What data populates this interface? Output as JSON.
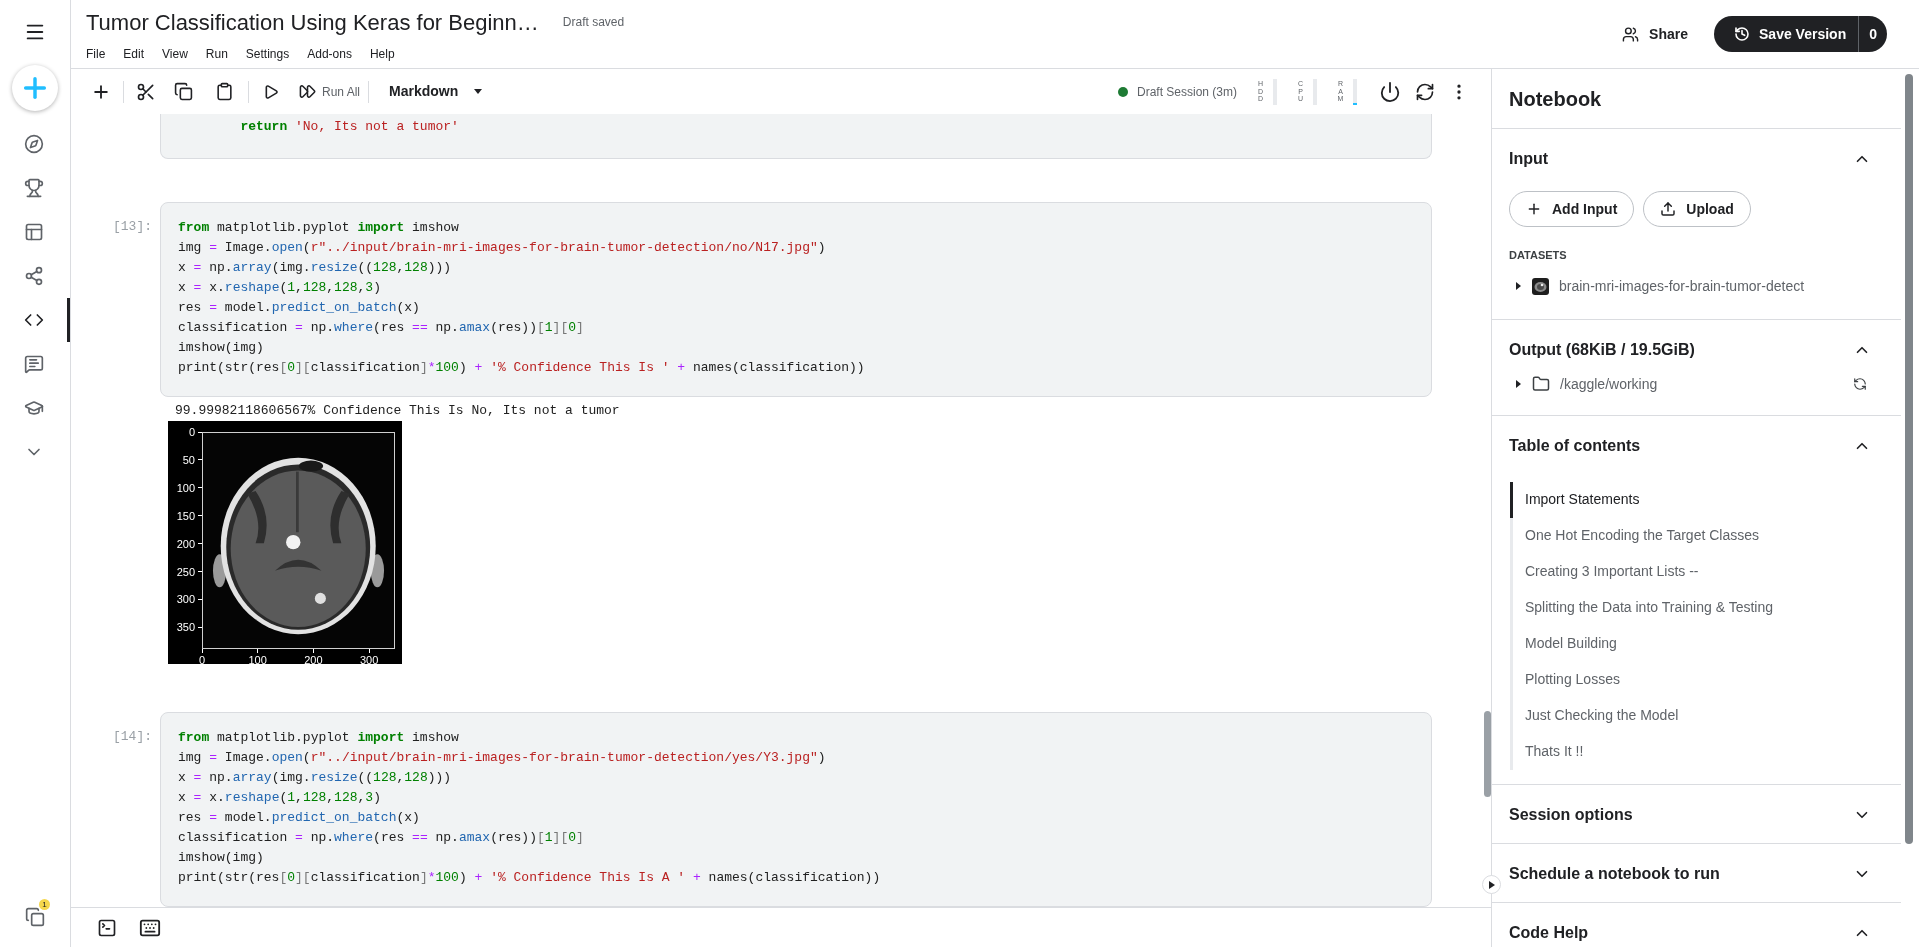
{
  "sidebar": {
    "items": [
      {
        "selected": false
      },
      {
        "selected": false
      },
      {
        "selected": false
      },
      {
        "selected": false
      },
      {
        "selected": true
      },
      {
        "selected": false
      },
      {
        "selected": false
      },
      {
        "selected": false
      }
    ],
    "badge": "1"
  },
  "header": {
    "title": "Tumor Classification Using Keras for Beginn…",
    "status": "Draft saved",
    "menu": [
      "File",
      "Edit",
      "View",
      "Run",
      "Settings",
      "Add-ons",
      "Help"
    ],
    "share": "Share",
    "save_version": {
      "label": "Save Version",
      "count": "0"
    }
  },
  "toolbar": {
    "run_all": "Run All",
    "cell_type": "Markdown",
    "session": {
      "label": "Draft Session (3m)",
      "running": true
    },
    "meters": [
      {
        "label": "HDD",
        "level": 0
      },
      {
        "label": "CPU",
        "level": 0
      },
      {
        "label": "RAM",
        "level": 0.06
      }
    ]
  },
  "cells": [
    {
      "lines": [
        [
          {
            "kind": "kw",
            "text": "        return"
          },
          {
            "kind": "str",
            "text": " 'No, Its not a tumor'"
          }
        ]
      ]
    },
    {
      "label": "[13]:",
      "lines": [
        [
          {
            "kind": "kw",
            "text": "from"
          },
          {
            "kind": "plain",
            "text": " matplotlib.pyplot "
          },
          {
            "kind": "kw",
            "text": "import"
          },
          {
            "kind": "plain",
            "text": " imshow"
          }
        ],
        [
          {
            "kind": "plain",
            "text": "img "
          },
          {
            "kind": "op",
            "text": "="
          },
          {
            "kind": "plain",
            "text": " Image."
          },
          {
            "kind": "fn",
            "text": "open"
          },
          {
            "kind": "plain",
            "text": "("
          },
          {
            "kind": "str",
            "text": "r\"../input/brain-mri-images-for-brain-tumor-detection/no/N17.jpg\""
          },
          {
            "kind": "plain",
            "text": ")"
          }
        ],
        [
          {
            "kind": "plain",
            "text": "x "
          },
          {
            "kind": "op",
            "text": "="
          },
          {
            "kind": "plain",
            "text": " np."
          },
          {
            "kind": "fn",
            "text": "array"
          },
          {
            "kind": "plain",
            "text": "(img."
          },
          {
            "kind": "fn",
            "text": "resize"
          },
          {
            "kind": "plain",
            "text": "(("
          },
          {
            "kind": "num",
            "text": "128"
          },
          {
            "kind": "plain",
            "text": ","
          },
          {
            "kind": "num",
            "text": "128"
          },
          {
            "kind": "plain",
            "text": ")))"
          }
        ],
        [
          {
            "kind": "plain",
            "text": "x "
          },
          {
            "kind": "op",
            "text": "="
          },
          {
            "kind": "plain",
            "text": " x."
          },
          {
            "kind": "fn",
            "text": "reshape"
          },
          {
            "kind": "plain",
            "text": "("
          },
          {
            "kind": "num",
            "text": "1"
          },
          {
            "kind": "plain",
            "text": ","
          },
          {
            "kind": "num",
            "text": "128"
          },
          {
            "kind": "plain",
            "text": ","
          },
          {
            "kind": "num",
            "text": "128"
          },
          {
            "kind": "plain",
            "text": ","
          },
          {
            "kind": "num",
            "text": "3"
          },
          {
            "kind": "plain",
            "text": ")"
          }
        ],
        [
          {
            "kind": "plain",
            "text": "res "
          },
          {
            "kind": "op",
            "text": "="
          },
          {
            "kind": "plain",
            "text": " model."
          },
          {
            "kind": "fn",
            "text": "predict_on_batch"
          },
          {
            "kind": "plain",
            "text": "(x)"
          }
        ],
        [
          {
            "kind": "plain",
            "text": "classification "
          },
          {
            "kind": "op",
            "text": "="
          },
          {
            "kind": "plain",
            "text": " np."
          },
          {
            "kind": "fn",
            "text": "where"
          },
          {
            "kind": "plain",
            "text": "(res "
          },
          {
            "kind": "op",
            "text": "=="
          },
          {
            "kind": "plain",
            "text": " np."
          },
          {
            "kind": "fn",
            "text": "amax"
          },
          {
            "kind": "plain",
            "text": "(res))"
          },
          {
            "kind": "br",
            "text": "["
          },
          {
            "kind": "num",
            "text": "1"
          },
          {
            "kind": "br",
            "text": "]["
          },
          {
            "kind": "num",
            "text": "0"
          },
          {
            "kind": "br",
            "text": "]"
          }
        ],
        [
          {
            "kind": "plain",
            "text": "imshow(img)"
          }
        ],
        [
          {
            "kind": "plain",
            "text": "print(str(res"
          },
          {
            "kind": "br",
            "text": "["
          },
          {
            "kind": "num",
            "text": "0"
          },
          {
            "kind": "br",
            "text": "]["
          },
          {
            "kind": "plain",
            "text": "classification"
          },
          {
            "kind": "br",
            "text": "]"
          },
          {
            "kind": "op",
            "text": "*"
          },
          {
            "kind": "num",
            "text": "100"
          },
          {
            "kind": "plain",
            "text": ") "
          },
          {
            "kind": "op",
            "text": "+"
          },
          {
            "kind": "str",
            "text": " '% Confidence This Is '"
          },
          {
            "kind": "op",
            "text": " +"
          },
          {
            "kind": "plain",
            "text": " names(classification))"
          }
        ]
      ],
      "output": {
        "text": "99.99982118606567% Confidence This Is No, Its not a tumor",
        "plot": {
          "kind": "picture",
          "yticks": [
            "0",
            "50",
            "100",
            "150",
            "200",
            "250",
            "300",
            "350"
          ],
          "xticks": [
            "0",
            "100",
            "200",
            "300"
          ]
        }
      }
    },
    {
      "label": "[14]:",
      "lines": [
        [
          {
            "kind": "kw",
            "text": "from"
          },
          {
            "kind": "plain",
            "text": " matplotlib.pyplot "
          },
          {
            "kind": "kw",
            "text": "import"
          },
          {
            "kind": "plain",
            "text": " imshow"
          }
        ],
        [
          {
            "kind": "plain",
            "text": "img "
          },
          {
            "kind": "op",
            "text": "="
          },
          {
            "kind": "plain",
            "text": " Image."
          },
          {
            "kind": "fn",
            "text": "open"
          },
          {
            "kind": "plain",
            "text": "("
          },
          {
            "kind": "str",
            "text": "r\"../input/brain-mri-images-for-brain-tumor-detection/yes/Y3.jpg\""
          },
          {
            "kind": "plain",
            "text": ")"
          }
        ],
        [
          {
            "kind": "plain",
            "text": "x "
          },
          {
            "kind": "op",
            "text": "="
          },
          {
            "kind": "plain",
            "text": " np."
          },
          {
            "kind": "fn",
            "text": "array"
          },
          {
            "kind": "plain",
            "text": "(img."
          },
          {
            "kind": "fn",
            "text": "resize"
          },
          {
            "kind": "plain",
            "text": "(("
          },
          {
            "kind": "num",
            "text": "128"
          },
          {
            "kind": "plain",
            "text": ","
          },
          {
            "kind": "num",
            "text": "128"
          },
          {
            "kind": "plain",
            "text": ")))"
          }
        ],
        [
          {
            "kind": "plain",
            "text": "x "
          },
          {
            "kind": "op",
            "text": "="
          },
          {
            "kind": "plain",
            "text": " x."
          },
          {
            "kind": "fn",
            "text": "reshape"
          },
          {
            "kind": "plain",
            "text": "("
          },
          {
            "kind": "num",
            "text": "1"
          },
          {
            "kind": "plain",
            "text": ","
          },
          {
            "kind": "num",
            "text": "128"
          },
          {
            "kind": "plain",
            "text": ","
          },
          {
            "kind": "num",
            "text": "128"
          },
          {
            "kind": "plain",
            "text": ","
          },
          {
            "kind": "num",
            "text": "3"
          },
          {
            "kind": "plain",
            "text": ")"
          }
        ],
        [
          {
            "kind": "plain",
            "text": "res "
          },
          {
            "kind": "op",
            "text": "="
          },
          {
            "kind": "plain",
            "text": " model."
          },
          {
            "kind": "fn",
            "text": "predict_on_batch"
          },
          {
            "kind": "plain",
            "text": "(x)"
          }
        ],
        [
          {
            "kind": "plain",
            "text": "classification "
          },
          {
            "kind": "op",
            "text": "="
          },
          {
            "kind": "plain",
            "text": " np."
          },
          {
            "kind": "fn",
            "text": "where"
          },
          {
            "kind": "plain",
            "text": "(res "
          },
          {
            "kind": "op",
            "text": "=="
          },
          {
            "kind": "plain",
            "text": " np."
          },
          {
            "kind": "fn",
            "text": "amax"
          },
          {
            "kind": "plain",
            "text": "(res))"
          },
          {
            "kind": "br",
            "text": "["
          },
          {
            "kind": "num",
            "text": "1"
          },
          {
            "kind": "br",
            "text": "]["
          },
          {
            "kind": "num",
            "text": "0"
          },
          {
            "kind": "br",
            "text": "]"
          }
        ],
        [
          {
            "kind": "plain",
            "text": "imshow(img)"
          }
        ],
        [
          {
            "kind": "plain",
            "text": "print(str(res"
          },
          {
            "kind": "br",
            "text": "["
          },
          {
            "kind": "num",
            "text": "0"
          },
          {
            "kind": "br",
            "text": "]["
          },
          {
            "kind": "plain",
            "text": "classification"
          },
          {
            "kind": "br",
            "text": "]"
          },
          {
            "kind": "op",
            "text": "*"
          },
          {
            "kind": "num",
            "text": "100"
          },
          {
            "kind": "plain",
            "text": ") "
          },
          {
            "kind": "op",
            "text": "+"
          },
          {
            "kind": "str",
            "text": " '% Confidence This Is A '"
          },
          {
            "kind": "op",
            "text": " +"
          },
          {
            "kind": "plain",
            "text": " names(classification))"
          }
        ]
      ]
    }
  ],
  "panel": {
    "title": "Notebook",
    "sections": [
      {
        "kind": "input",
        "title": "Input",
        "expanded": true,
        "buttons": [
          "Add Input",
          "Upload"
        ],
        "group_label": "DATASETS",
        "items": [
          {
            "name": "brain-mri-images-for-brain-tumor-detect",
            "expanded": false
          }
        ]
      },
      {
        "kind": "output",
        "title": "Output (68KiB / 19.5GiB)",
        "expanded": true,
        "items": [
          {
            "name": "/kaggle/working",
            "expanded": false
          }
        ]
      },
      {
        "kind": "toc",
        "title": "Table of contents",
        "expanded": true,
        "entries": [
          {
            "label": "Import Statements",
            "selected": true
          },
          {
            "label": "One Hot Encoding the Target Classes",
            "selected": false
          },
          {
            "label": "Creating 3 Important Lists --",
            "selected": false
          },
          {
            "label": "Splitting the Data into Training & Testing",
            "selected": false
          },
          {
            "label": "Model Building",
            "selected": false
          },
          {
            "label": "Plotting Losses",
            "selected": false
          },
          {
            "label": "Just Checking the Model",
            "selected": false
          },
          {
            "label": "Thats It !!",
            "selected": false
          }
        ]
      },
      {
        "kind": "plain",
        "title": "Session options",
        "expanded": false
      },
      {
        "kind": "plain",
        "title": "Schedule a notebook to run",
        "expanded": false
      },
      {
        "kind": "plain",
        "title": "Code Help",
        "expanded": true
      }
    ]
  }
}
